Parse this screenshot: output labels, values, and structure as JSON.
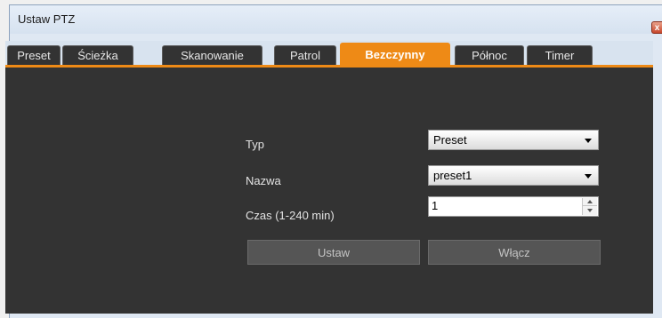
{
  "window": {
    "title": "Ustaw PTZ",
    "close_glyph": "x"
  },
  "tabs": [
    {
      "label": "Preset",
      "active": false
    },
    {
      "label": "Ścieżka",
      "active": false
    },
    {
      "label": "Skanowanie",
      "active": false
    },
    {
      "label": "Patrol",
      "active": false
    },
    {
      "label": "Bezczynny",
      "active": true
    },
    {
      "label": "Północ",
      "active": false
    },
    {
      "label": "Timer",
      "active": false
    }
  ],
  "form": {
    "type_label": "Typ",
    "type_value": "Preset",
    "name_label": "Nazwa",
    "name_value": "preset1",
    "time_label": "Czas (1-240 min)",
    "time_value": "1"
  },
  "buttons": {
    "set_label": "Ustaw",
    "enable_label": "Włącz"
  },
  "colors": {
    "accent": "#ee8a16",
    "panel_bg": "#333333",
    "button_bg": "#555555"
  }
}
